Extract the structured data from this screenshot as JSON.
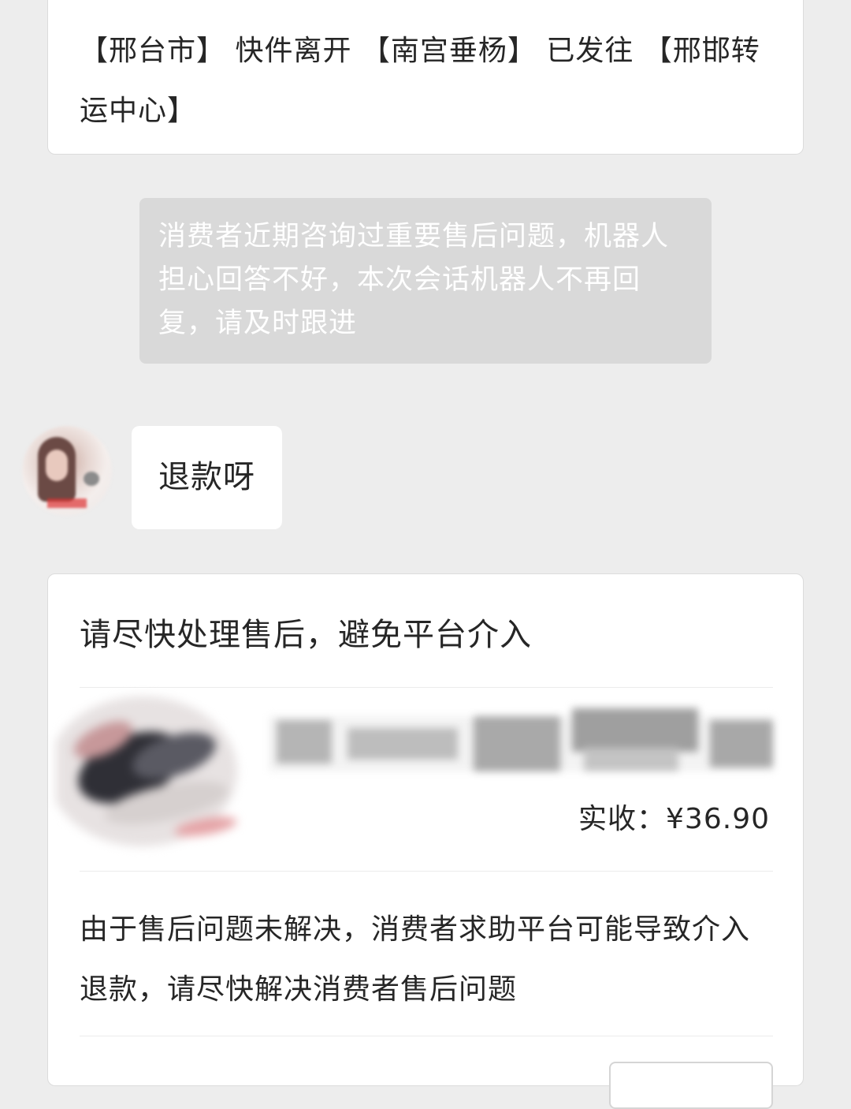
{
  "logistics": {
    "text": "【邢台市】 快件离开 【南宫垂杨】 已发往 【邢邯转运中心】"
  },
  "system_notice": {
    "text": "消费者近期咨询过重要售后问题，机器人担心回答不好，本次会话机器人不再回复，请及时跟进"
  },
  "chat": {
    "customer_message": "退款呀"
  },
  "aftersale_card": {
    "title": "请尽快处理售后，避免平台介入",
    "price_label": "实收：",
    "price_value": "¥36.90",
    "notice": "由于售后问题未解决，消费者求助平台可能导致介入退款，请尽快解决消费者售后问题"
  },
  "colors": {
    "background": "#ededed",
    "card": "#ffffff",
    "system_bubble": "#d9d9d9",
    "system_text": "#ffffff",
    "text": "#262626"
  }
}
